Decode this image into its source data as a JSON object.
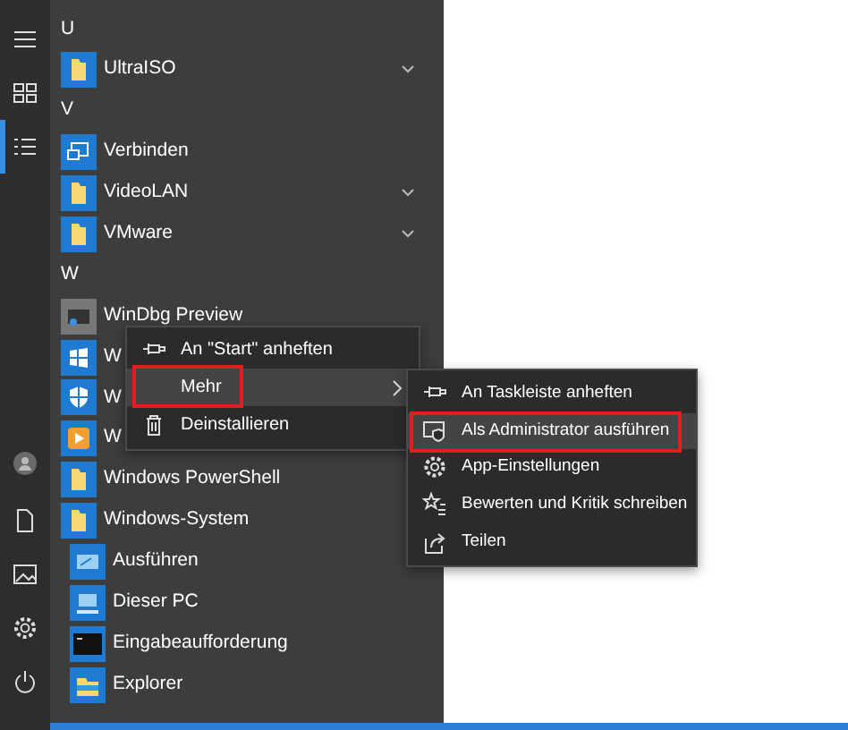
{
  "nav_rail": {
    "top": [
      {
        "selected": false
      },
      {
        "selected": false
      },
      {
        "selected": true
      }
    ]
  },
  "app_list": [
    {
      "kind": "header",
      "label": "U"
    },
    {
      "kind": "app",
      "label": "UltraISO",
      "has_chevron": true
    },
    {
      "kind": "header",
      "label": "V"
    },
    {
      "kind": "app",
      "label": "Verbinden",
      "has_chevron": false
    },
    {
      "kind": "app",
      "label": "VideoLAN",
      "has_chevron": true
    },
    {
      "kind": "app",
      "label": "VMware",
      "has_chevron": true
    },
    {
      "kind": "header",
      "label": "W"
    },
    {
      "kind": "app",
      "label": "WinDbg Preview",
      "has_chevron": false
    },
    {
      "kind": "app",
      "label": "W",
      "has_chevron": false
    },
    {
      "kind": "app",
      "label": "W",
      "has_chevron": false
    },
    {
      "kind": "app",
      "label": "W",
      "has_chevron": false
    },
    {
      "kind": "app",
      "label": "Windows PowerShell",
      "has_chevron": false
    },
    {
      "kind": "app",
      "label": "Windows-System",
      "has_chevron": false,
      "children": [
        {
          "kind": "app",
          "label": "Ausführen",
          "has_chevron": false
        },
        {
          "kind": "app",
          "label": "Dieser PC",
          "has_chevron": false
        },
        {
          "kind": "app",
          "label": "Eingabeaufforderung",
          "has_chevron": false
        },
        {
          "kind": "app",
          "label": "Explorer",
          "has_chevron": false
        }
      ]
    }
  ],
  "context_menu": {
    "items": [
      {
        "label": "An \"Start\" anheften",
        "selected": false,
        "outlined": false,
        "has_submenu": false
      },
      {
        "label": "Mehr",
        "selected": true,
        "outlined": true,
        "has_submenu": true
      },
      {
        "label": "Deinstallieren",
        "selected": false,
        "outlined": false,
        "has_submenu": false
      }
    ]
  },
  "submenu": {
    "items": [
      {
        "label": "An Taskleiste anheften",
        "selected": false,
        "outlined": false
      },
      {
        "label": "Als Administrator ausführen",
        "selected": true,
        "outlined": true
      },
      {
        "label": "App-Einstellungen",
        "selected": false,
        "outlined": false
      },
      {
        "label": "Bewerten und Kritik schreiben",
        "selected": false,
        "outlined": false
      },
      {
        "label": "Teilen",
        "selected": false,
        "outlined": false
      }
    ]
  }
}
